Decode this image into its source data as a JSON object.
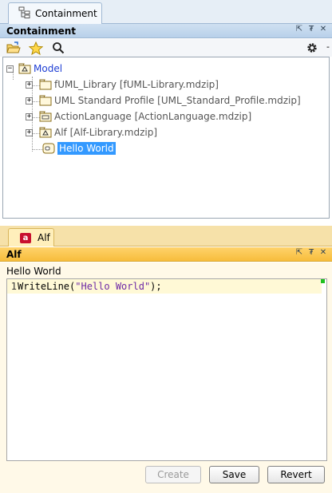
{
  "containment": {
    "tab_label": "Containment",
    "title": "Containment",
    "tree": {
      "root": "Model",
      "items": [
        {
          "label": "fUML_Library [fUML-Library.mdzip]"
        },
        {
          "label": "UML Standard Profile [UML_Standard_Profile.mdzip]"
        },
        {
          "label": "ActionLanguage [ActionLanguage.mdzip]"
        },
        {
          "label": "Alf [Alf-Library.mdzip]"
        },
        {
          "label": "Hello World",
          "selected": true
        }
      ]
    },
    "toolbar_icons": [
      "open-folder-icon",
      "star-icon",
      "search-icon",
      "gear-icon"
    ]
  },
  "alf": {
    "tab_label": "Alf",
    "title": "Alf",
    "element_name": "Hello World",
    "code": {
      "line_number": "1",
      "prefix": "WriteLine(",
      "string": "\"Hello World\"",
      "suffix": ");"
    },
    "buttons": {
      "create": "Create",
      "save": "Save",
      "revert": "Revert"
    }
  },
  "colors": {
    "selection": "#3399ff",
    "model_text": "#1f3fd4",
    "alf_header": "#f7bd3c",
    "containment_header": "#b8d0ea"
  }
}
